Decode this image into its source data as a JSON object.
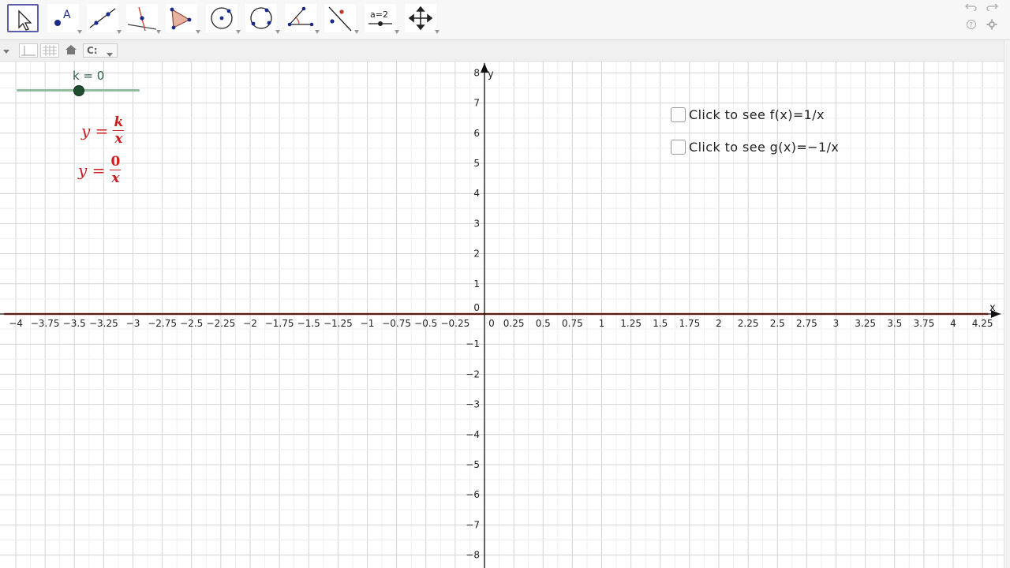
{
  "toolbar": {
    "tools": [
      {
        "name": "move-tool",
        "icon": "move-arrow-icon",
        "selected": true
      },
      {
        "name": "point-tool",
        "icon": "point-icon"
      },
      {
        "name": "line-tool",
        "icon": "line-icon"
      },
      {
        "name": "perpendicular-tool",
        "icon": "perpendicular-line-icon"
      },
      {
        "name": "polygon-tool",
        "icon": "polygon-icon"
      },
      {
        "name": "circle-center-tool",
        "icon": "circle-center-icon"
      },
      {
        "name": "circle-three-points-tool",
        "icon": "circle-three-points-icon"
      },
      {
        "name": "angle-tool",
        "icon": "angle-icon"
      },
      {
        "name": "reflect-tool",
        "icon": "reflect-line-icon"
      },
      {
        "name": "slider-tool",
        "icon": "slider-icon",
        "label": "a=2"
      },
      {
        "name": "move-view-tool",
        "icon": "move-view-icon"
      }
    ],
    "undo_icon": "undo-icon",
    "redo_icon": "redo-icon",
    "help_icon": "help-icon",
    "settings_icon": "gear-icon"
  },
  "view_bar": {
    "collapse_icon": "triangle-down-icon",
    "axes_toggle_icon": "axes-toggle-icon",
    "grid_toggle_icon": "grid-toggle-icon",
    "home_icon": "home-icon",
    "label_style": "C:"
  },
  "slider": {
    "label": "k = 0",
    "value": 0,
    "min": -5,
    "max": 5
  },
  "formulas": {
    "general": {
      "lhs": "y =",
      "numerator": "k",
      "denominator": "x"
    },
    "specific": {
      "lhs": "y =",
      "numerator": "0",
      "denominator": "x"
    }
  },
  "checkboxes": [
    {
      "label": "Click to see f(x)=1/x",
      "checked": false
    },
    {
      "label": "Click to see g(x)=−1/x",
      "checked": false
    }
  ],
  "chart_data": {
    "type": "line",
    "xlabel": "x",
    "ylabel": "y",
    "xlim": [
      -4.1,
      4.3
    ],
    "ylim": [
      -8.4,
      8.2
    ],
    "grid": true,
    "x_ticks": [
      "-4",
      "-3.75",
      "-3.5",
      "-3.25",
      "-3",
      "-2.75",
      "-2.5",
      "-2.25",
      "-2",
      "-1.75",
      "-1.5",
      "-1.25",
      "-1",
      "-0.75",
      "-0.5",
      "-0.25",
      "0",
      "0.25",
      "0.5",
      "0.75",
      "1",
      "1.25",
      "1.5",
      "1.75",
      "2",
      "2.25",
      "2.5",
      "2.75",
      "3",
      "3.25",
      "3.5",
      "3.75",
      "4",
      "4.25"
    ],
    "y_ticks": [
      "8",
      "7",
      "6",
      "5",
      "4",
      "3",
      "2",
      "1",
      "0",
      "-1",
      "-2",
      "-3",
      "-4",
      "-5",
      "-6",
      "-7",
      "-8"
    ],
    "series": [
      {
        "name": "",
        "function": "y = k/x with k = 0",
        "x": [
          -4.1,
          4.3
        ],
        "y": [
          0,
          0
        ],
        "color": "#c0392b"
      }
    ],
    "axis_color": "#111111",
    "grid_color": "#d9d9d9"
  }
}
